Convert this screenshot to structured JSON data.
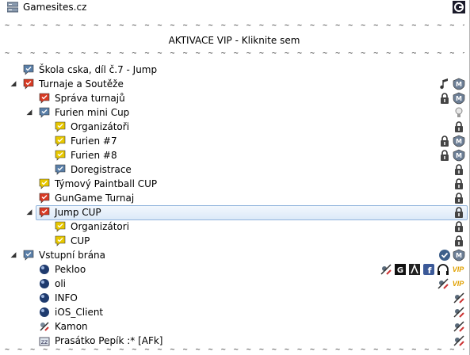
{
  "server": {
    "name": "Gamesites.cz"
  },
  "banner": {
    "dashes": "~ ~ ~ ~ ~ ~ ~ ~ ~ ~ ~ ~ ~ ~ ~ ~ ~ ~ ~ ~ ~ ~ ~ ~ ~ ~ ~ ~ ~ ~ ~ ~ ~ ~ ~ ~ ~ ~ ~ ~ ~ ~ ~ ~ ~ ~",
    "vip_label": "AKTIVACE VIP - Kliknite sem"
  },
  "channels": [
    {
      "name": "Škola cska, díl č.7 - Jump"
    },
    {
      "name": "Turnaje a Soutěže"
    },
    {
      "name": "Správa turnajů"
    },
    {
      "name": "Furien mini Cup"
    },
    {
      "name": "Organizátoři"
    },
    {
      "name": "Furien #7"
    },
    {
      "name": "Furien #8"
    },
    {
      "name": "Doregistrace"
    },
    {
      "name": "Týmový Paintball CUP"
    },
    {
      "name": "GunGame Turnaj"
    },
    {
      "name": "Jump CUP"
    },
    {
      "name": "Organizátori"
    },
    {
      "name": "CUP"
    },
    {
      "name": "Vstupní brána"
    }
  ],
  "clients": [
    {
      "name": "Pekloo",
      "badge": "VIP"
    },
    {
      "name": "oli",
      "badge": "VIP"
    },
    {
      "name": "INFO"
    },
    {
      "name": "iOS_Client"
    },
    {
      "name": "Kamon"
    },
    {
      "name": "Prasátko Pepík :* [AFk]"
    }
  ],
  "colors": {
    "selection": "#dbe9f8",
    "vip": "#e0a000",
    "bubble_red": "#d83a24",
    "bubble_yellow": "#e8c800",
    "bubble_blue": "#5a7fa8"
  }
}
